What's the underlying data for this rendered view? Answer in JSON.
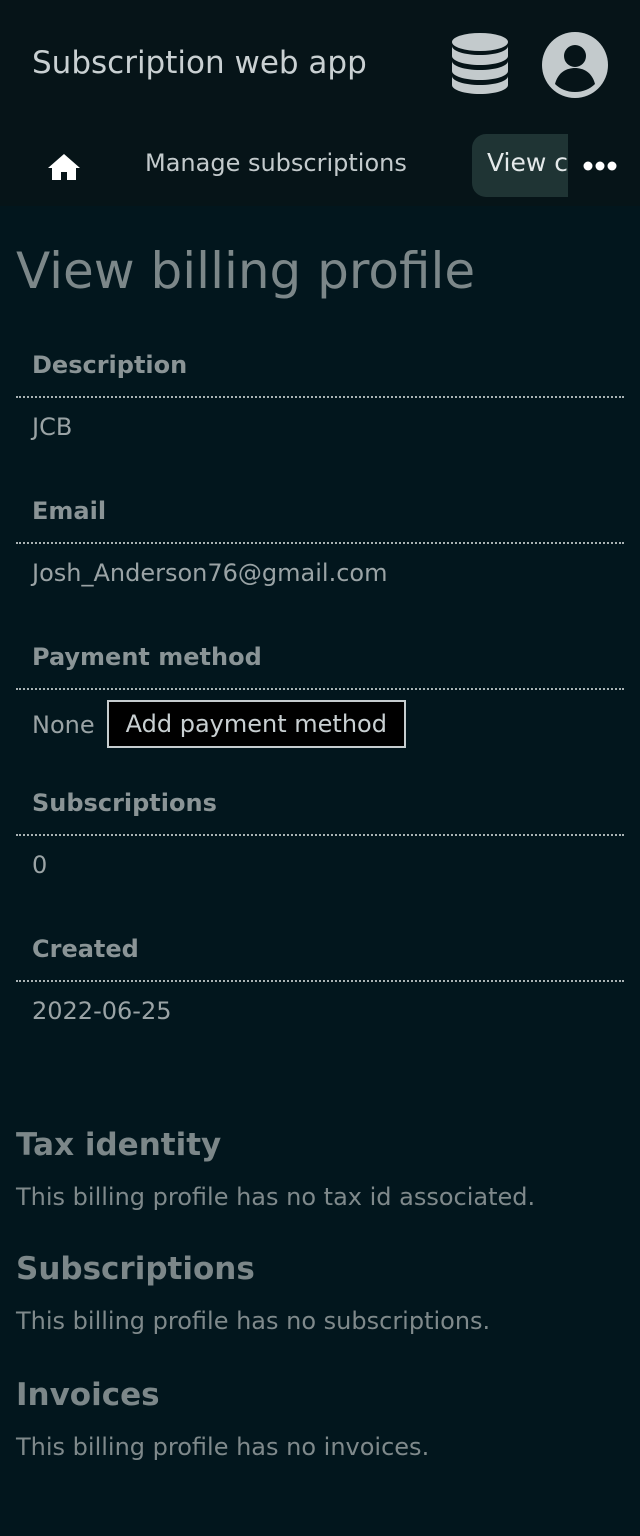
{
  "app": {
    "title": "Subscription web app",
    "database_icon": "database-icon",
    "user_icon": "user-circle-icon"
  },
  "nav": {
    "home_icon": "home-icon",
    "manage_label": "Manage subscriptions",
    "active_tab_label": "View c",
    "more_icon": "more-horizontal-icon"
  },
  "page": {
    "title": "View billing profile"
  },
  "details": {
    "description_label": "Description",
    "description_value": "JCB",
    "email_label": "Email",
    "email_value": "Josh_Anderson76@gmail.com",
    "payment_label": "Payment method",
    "payment_value": "None",
    "add_payment_label": "Add payment method",
    "subscriptions_label": "Subscriptions",
    "subscriptions_value": "0",
    "created_label": "Created",
    "created_value": "2022-06-25"
  },
  "sections": {
    "tax_heading": "Tax identity",
    "tax_text": "This billing profile has no tax id associated.",
    "subscriptions_heading": "Subscriptions",
    "subscriptions_text": "This billing profile has no subscriptions.",
    "invoices_heading": "Invoices",
    "invoices_text": "This billing profile has no invoices."
  },
  "colors": {
    "background": "#02161d",
    "header_background": "#061418",
    "active_tab": "#1f3434"
  }
}
